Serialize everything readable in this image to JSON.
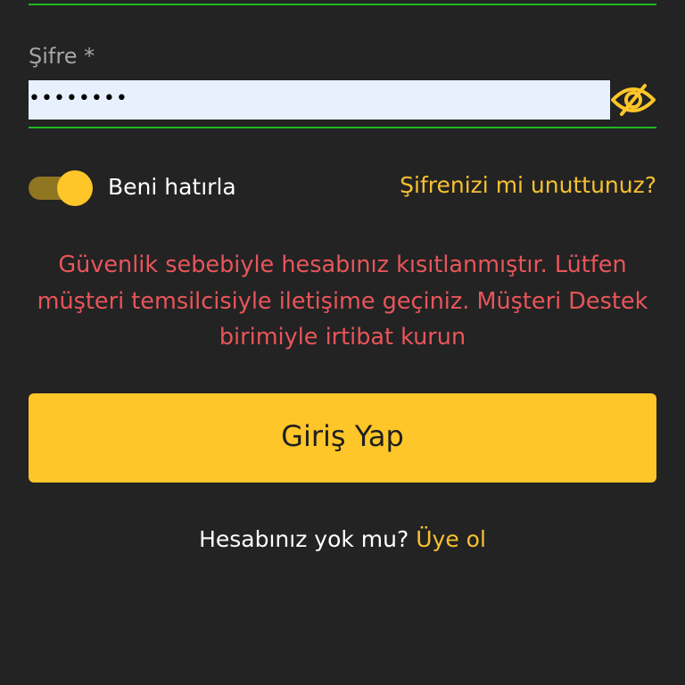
{
  "form": {
    "password": {
      "label": "Şifre *",
      "value": "........",
      "visibility_icon": "eye-slash-icon"
    },
    "remember_me": {
      "label": "Beni hatırla",
      "checked": true
    },
    "forgot_password_label": "Şifrenizi mi unuttunuz?",
    "error_message": "Güvenlik sebebiyle hesabınız kısıtlanmıştır. Lütfen müşteri temsilcisiyle iletişime geçiniz. Müşteri Destek birimiyle irtibat kurun",
    "login_button_label": "Giriş Yap",
    "signup_prompt": "Hesabınız yok mu?",
    "signup_link_label": "Üye ol"
  },
  "colors": {
    "background": "#232323",
    "accent": "#ffc629",
    "link": "#f7c131",
    "error": "#e8555a",
    "field_underline": "#1fb81f",
    "input_background": "#e8f0fe"
  }
}
